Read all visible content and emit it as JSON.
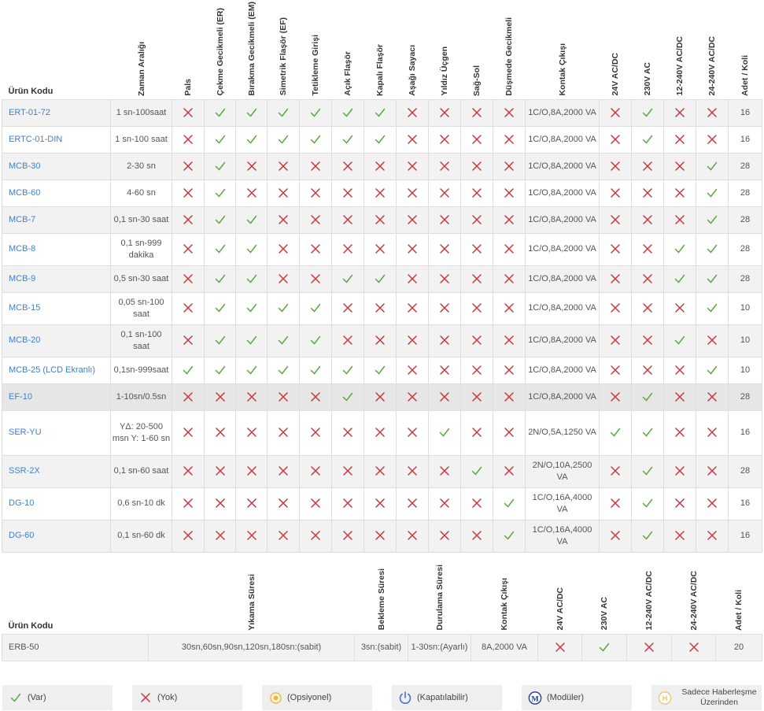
{
  "colors": {
    "check": "#5aa845",
    "cross": "#c9363c",
    "link": "#3f7fcf",
    "optional": "#f0b429",
    "closable": "#3a6fd0",
    "modular": "#1a3a8f",
    "message": "#f3c46a"
  },
  "products": {
    "code_header": "Ürün Kodu",
    "time_header": "Zaman Aralığı",
    "contact_header": "Kontak Çıkışı",
    "qty_header": "Adet / Koli",
    "feature_headers": [
      "Pals",
      "Çekme Gecikmeli (ER)",
      "Bırakma Gecikmeli (EM)",
      "Simetrik Flaşör (EF)",
      "Tetikleme Girişi",
      "Açık Flaşör",
      "Kapalı Flaşör",
      "Aşağı Sayacı",
      "Yıldız Üçgen",
      "Sağ-Sol",
      "Düşmede Gecikmeli"
    ],
    "voltage_headers": [
      "24V AC/DC",
      "230V AC",
      "12-240V AC/DC",
      "24-240V AC/DC"
    ],
    "rows": [
      {
        "code": "ERT-01-72",
        "time": "1 sn-100saat",
        "f": "0111111000",
        "v": "0100",
        "contact": "1C/O,8A,2000 VA",
        "qty": "16"
      },
      {
        "code": "ERTC-01-DIN",
        "time": "1 sn-100 saat",
        "f": "0111111000",
        "v": "0100",
        "contact": "1C/O,8A,2000 VA",
        "qty": "16"
      },
      {
        "code": "MCB-30",
        "time": "2-30 sn",
        "f": "0100000000",
        "v": "0001",
        "contact": "1C/O,8A,2000 VA",
        "qty": "28"
      },
      {
        "code": "MCB-60",
        "time": "4-60 sn",
        "f": "0100000000",
        "v": "0001",
        "contact": "1C/O,8A,2000 VA",
        "qty": "28"
      },
      {
        "code": "MCB-7",
        "time": "0,1 sn-30 saat",
        "f": "0110000000",
        "v": "0001",
        "contact": "1C/O,8A,2000 VA",
        "qty": "28"
      },
      {
        "code": "MCB-8",
        "time": "0,1 sn-999 dakika",
        "f": "0110000000",
        "v": "0011",
        "contact": "1C/O,8A,2000 VA",
        "qty": "28"
      },
      {
        "code": "MCB-9",
        "time": "0,5 sn-30 saat",
        "f": "0110011000",
        "v": "0011",
        "contact": "1C/O,8A,2000 VA",
        "qty": "28"
      },
      {
        "code": "MCB-15",
        "time": "0,05 sn-100 saat",
        "f": "0111100000",
        "v": "0001",
        "contact": "1C/O,8A,2000 VA",
        "qty": "10"
      },
      {
        "code": "MCB-20",
        "time": "0,1 sn-100 saat",
        "f": "0111100000",
        "v": "0010",
        "contact": "1C/O,8A,2000 VA",
        "qty": "10"
      },
      {
        "code": "MCB-25 (LCD Ekranlı)",
        "time": "0,1sn-999saat",
        "f": "1111111000",
        "v": "0001",
        "contact": "1C/O,8A,2000 VA",
        "qty": "10"
      },
      {
        "code": "EF-10",
        "time": "1-10sn/0.5sn",
        "f": "0000010000",
        "v": "0100",
        "contact": "1C/O,8A,2000 VA",
        "qty": "28"
      },
      {
        "code": "SER-YU",
        "time": "YΔ: 20-500 msn Y: 1-60 sn",
        "f": "0000000010",
        "v": "1100",
        "contact": "2N/O,5A,1250 VA",
        "qty": "16"
      },
      {
        "code": "SSR-2X",
        "time": "0,1 sn-60 saat",
        "f": "0000000001",
        "v": "0100",
        "contact": "2N/O,10A,2500 VA",
        "qty": "28"
      },
      {
        "code": "DG-10",
        "time": "0,6 sn-10 dk",
        "f": "00000000001",
        "v": "0100",
        "contact": "1C/O,16A,4000 VA",
        "qty": "16"
      },
      {
        "code": "DG-60",
        "time": "0,1 sn-60 dk",
        "f": "00000000001",
        "v": "0100",
        "contact": "1C/O,16A,4000 VA",
        "qty": "16"
      }
    ]
  },
  "washer": {
    "code_header": "Ürün Kodu",
    "headers": [
      "Yıkama Süresi",
      "Bekleme Süresi",
      "Durulama Süresi",
      "Kontak Çıkışı"
    ],
    "voltage_headers": [
      "24V AC/DC",
      "230V AC",
      "12-240V AC/DC",
      "24-240V AC/DC"
    ],
    "qty_header": "Adet / Koli",
    "row": {
      "code": "ERB-50",
      "wash": "30sn,60sn,90sn,120sn,180sn:(sabit)",
      "wait": "3sn:(sabit)",
      "rinse": "1-30sn:(Ayarlı)",
      "contact": "8A,2000 VA",
      "v": "0100",
      "qty": "20"
    }
  },
  "legend": [
    {
      "icon": "check-icon",
      "label": "(Var)"
    },
    {
      "icon": "cross-icon",
      "label": "(Yok)"
    },
    {
      "icon": "optional-icon",
      "label": "(Opsiyonel)"
    },
    {
      "icon": "power-icon",
      "label": "(Kapatılabilir)"
    },
    {
      "icon": "modular-icon",
      "label": "(Modüler)",
      "glyph": "M"
    },
    {
      "icon": "message-icon",
      "label": "Sadece Haberleşme Üzerinden",
      "glyph": "H"
    }
  ]
}
